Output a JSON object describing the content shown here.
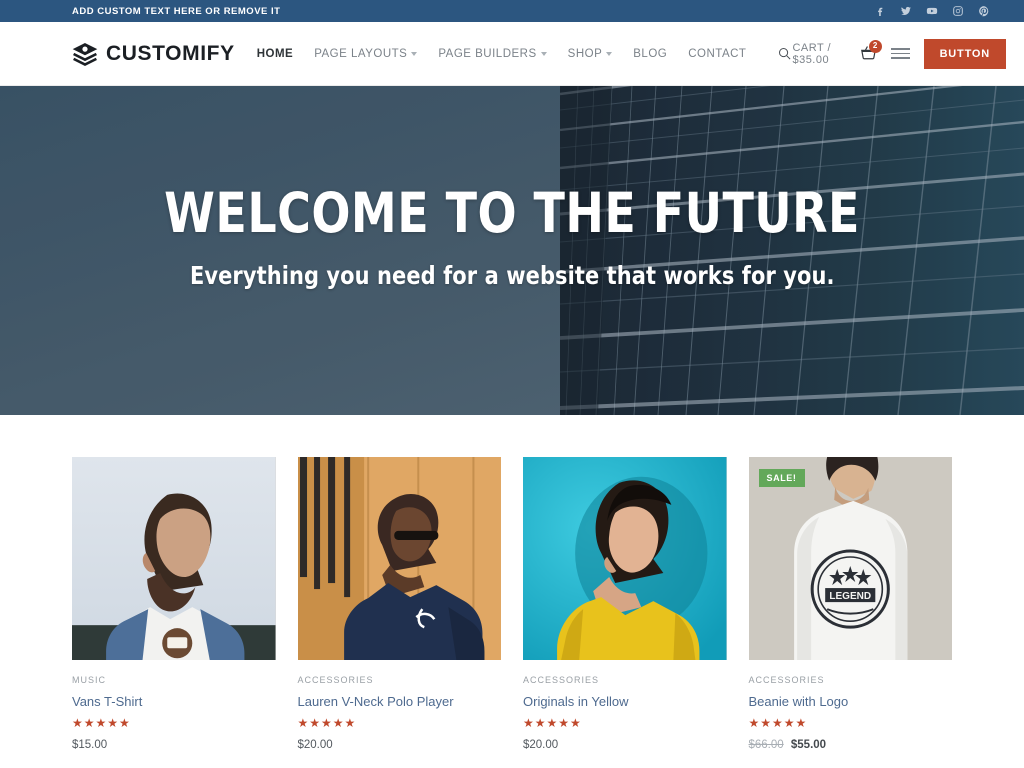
{
  "topbar": {
    "text": "ADD CUSTOM TEXT HERE OR REMOVE IT",
    "background": "#2c5680",
    "social": [
      {
        "name": "facebook-icon",
        "label": "Facebook"
      },
      {
        "name": "twitter-icon",
        "label": "Twitter"
      },
      {
        "name": "youtube-icon",
        "label": "YouTube"
      },
      {
        "name": "instagram-icon",
        "label": "Instagram"
      },
      {
        "name": "pinterest-icon",
        "label": "Pinterest"
      }
    ]
  },
  "header": {
    "logo_text": "CUSTOMIFY",
    "nav": [
      {
        "label": "HOME",
        "has_dropdown": false,
        "active": true
      },
      {
        "label": "PAGE LAYOUTS",
        "has_dropdown": true,
        "active": false
      },
      {
        "label": "PAGE BUILDERS",
        "has_dropdown": true,
        "active": false
      },
      {
        "label": "SHOP",
        "has_dropdown": true,
        "active": false
      },
      {
        "label": "BLOG",
        "has_dropdown": false,
        "active": false
      },
      {
        "label": "CONTACT",
        "has_dropdown": false,
        "active": false
      }
    ],
    "cart_label": "CART / $35.00",
    "cart_count": "2",
    "button_label": "BUTTON",
    "accent_color": "#c0492c"
  },
  "hero": {
    "title": "WELCOME TO THE FUTURE",
    "subtitle": "Everything you need for a website that works for you."
  },
  "products": [
    {
      "category": "MUSIC",
      "title": "Vans T-Shirt",
      "stars": "★★★★★",
      "price": "$15.00",
      "old_price": "",
      "sale": false,
      "sale_label": ""
    },
    {
      "category": "ACCESSORIES",
      "title": "Lauren V-Neck Polo Player",
      "stars": "★★★★★",
      "price": "$20.00",
      "old_price": "",
      "sale": false,
      "sale_label": ""
    },
    {
      "category": "ACCESSORIES",
      "title": "Originals in Yellow",
      "stars": "★★★★★",
      "price": "$20.00",
      "old_price": "",
      "sale": false,
      "sale_label": ""
    },
    {
      "category": "ACCESSORIES",
      "title": "Beanie with Logo",
      "stars": "★★★★★",
      "price": "$55.00",
      "old_price": "$66.00",
      "sale": true,
      "sale_label": "SALE!"
    }
  ]
}
